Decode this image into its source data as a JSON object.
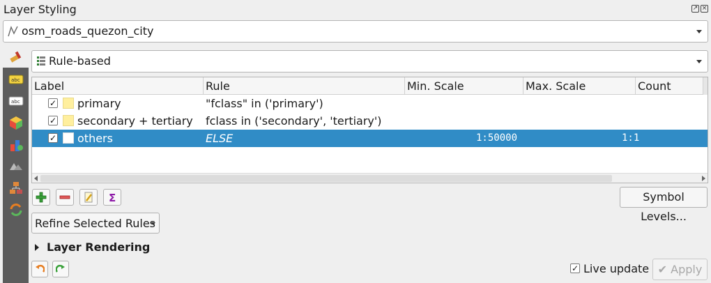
{
  "panel": {
    "title": "Layer Styling"
  },
  "layer_selector": {
    "value": "osm_roads_quezon_city"
  },
  "renderer_selector": {
    "value": "Rule-based"
  },
  "rules_table": {
    "columns": [
      "Label",
      "Rule",
      "Min. Scale",
      "Max. Scale",
      "Count"
    ],
    "rows": [
      {
        "label": "primary",
        "rule": "\"fclass\" in ('primary')",
        "min_scale": "",
        "max_scale": "",
        "count": "",
        "checked": true,
        "selected": false,
        "symbol_color": "#ffef9e"
      },
      {
        "label": "secondary + tertiary",
        "rule": "fclass in ('secondary', 'tertiary')",
        "min_scale": "",
        "max_scale": "",
        "count": "",
        "checked": true,
        "selected": false,
        "symbol_color": "#ffef9e"
      },
      {
        "label": "others",
        "rule": "ELSE",
        "min_scale": "1:50000",
        "max_scale": "",
        "count": "1:1",
        "checked": true,
        "selected": true,
        "symbol_color": "#ffffff"
      }
    ]
  },
  "toolbar": {
    "add_icon": "plus-icon",
    "remove_icon": "minus-icon",
    "edit_icon": "edit-pencil-icon",
    "count_icon": "sigma-icon",
    "symbol_levels_label": "Symbol Levels..."
  },
  "refine": {
    "label": "Refine Selected Rules"
  },
  "layer_rendering": {
    "label": "Layer Rendering"
  },
  "footer": {
    "live_update_label": "Live update",
    "live_update_checked": true,
    "apply_label": "Apply"
  },
  "colors": {
    "selection": "#308cc6",
    "panel_bg": "#efefef",
    "side_strip": "#5c5c5c"
  }
}
